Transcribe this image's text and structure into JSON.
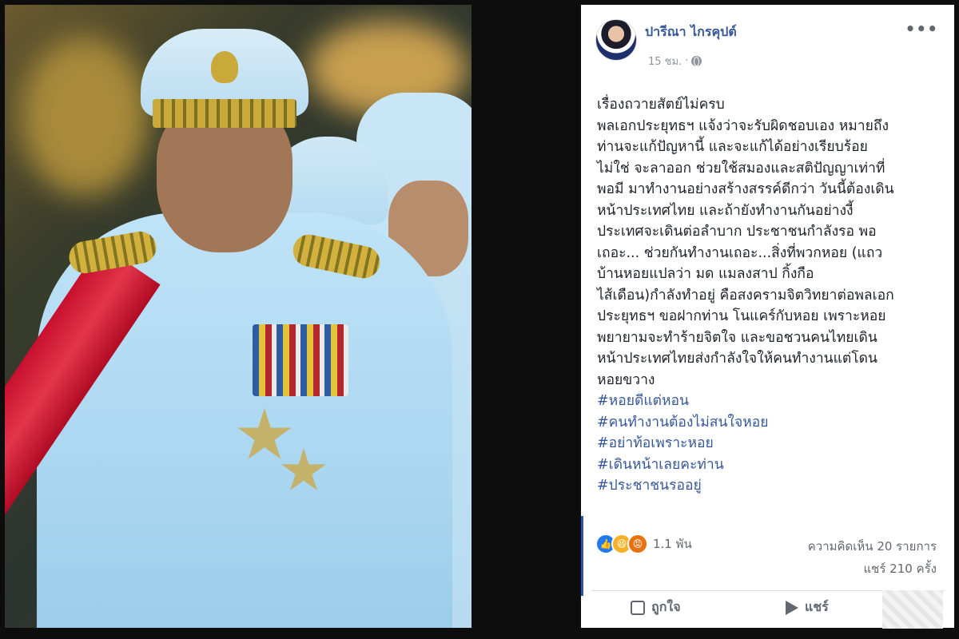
{
  "post": {
    "author": "ปารีณา ไกรคุปต์",
    "time": "15 ชม.",
    "more_label": "•••",
    "lines": [
      "เรื่องถวายสัตย์ไม่ครบ",
      "พลเอกประยุทธฯ แจ้งว่าจะรับผิดชอบเอง หมายถึง",
      "ท่านจะแก้ปัญหานี้ และจะแก้ได้อย่างเรียบร้อย",
      "ไม่ใช่ จะลาออก ช่วยใช้สมองและสติปัญญาเท่าที่",
      "พอมี มาทำงานอย่างสร้างสรรค์ดีกว่า วันนี้ต้องเดิน",
      "หน้าประเทศไทย และถ้ายังทำงานกันอย่างงี้",
      "ประเทศจะเดินต่อลำบาก ประชาชนกำลังรอ พอ",
      "เถอะ... ช่วยกันทำงานเถอะ...สิ่งที่พวกหอย (แถว",
      "บ้านหอยแปลว่า มด แมลงสาป กิ้งกือ",
      "ไส้เดือน)กำลังทำอยู่ คือสงครามจิตวิทยาต่อพลเอก",
      "ประยุทธฯ ขอฝากท่าน โนแคร์กับหอย เพราะหอย",
      "พยายามจะทำร้ายจิตใจ และขอชวนคนไทยเดิน",
      "หน้าประเทศไทยส่งกำลังใจให้คนทำงานแต่โดน",
      "หอยขวาง"
    ],
    "hashtags": [
      "#หอยดีแต่หอน",
      "#คนทำงานต้องไม่สนใจหอย",
      "#อย่าท้อเพราะหอย",
      "#เดินหน้าเลยคะท่าน",
      "#ประชาชนรออยู่"
    ],
    "reaction_count": "1.1 พัน",
    "comments": "ความคิดเห็น 20 รายการ",
    "shares": "แชร์ 210 ครั้ง",
    "like_label": "ถูกใจ",
    "share_label": "แชร์"
  },
  "colors": {
    "link": "#365899",
    "muted": "#606770",
    "like": "#2078f4",
    "haha": "#f7b125",
    "angry": "#e9710f"
  },
  "icons": [
    "more-icon",
    "globe-icon",
    "like-reaction-icon",
    "haha-reaction-icon",
    "angry-reaction-icon",
    "like-thumb-icon",
    "share-arrow-icon"
  ]
}
